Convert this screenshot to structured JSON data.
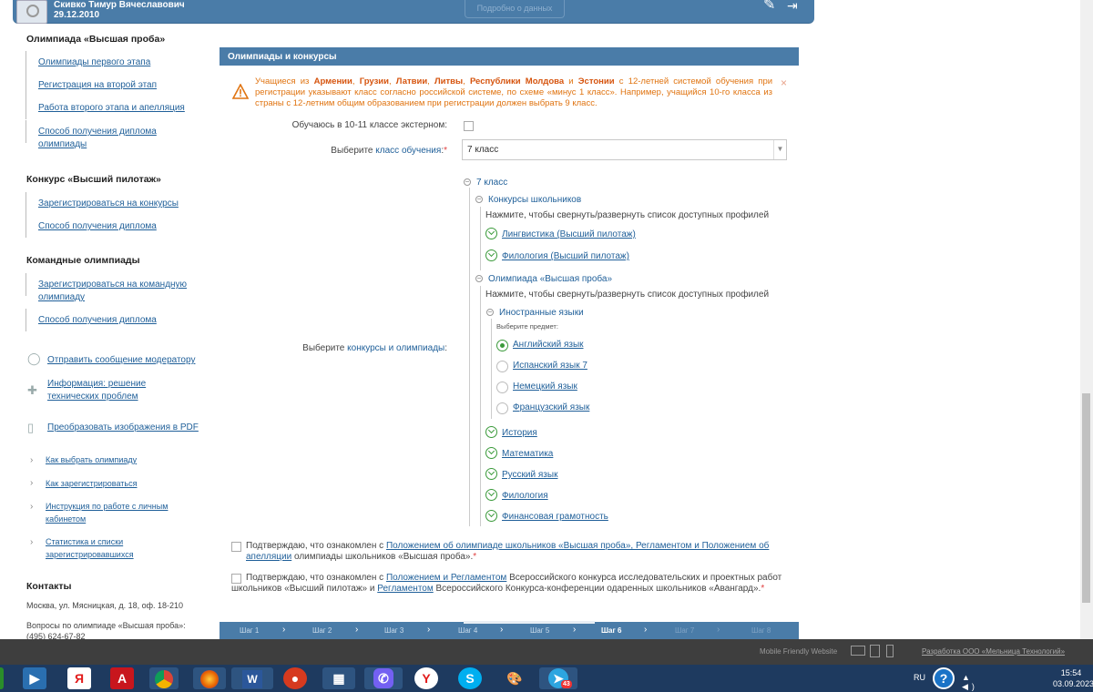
{
  "header": {
    "user_name": "Скивко Тимур Вячеславович",
    "user_date": "29.12.2010",
    "button_label": "Подробно о данных",
    "icons": [
      "pen-icon",
      "logout-icon"
    ]
  },
  "sidebar": {
    "section1_title": "Олимпиада «Высшая проба»",
    "section1_items": [
      "Олимпиады первого этапа",
      "Регистрация на второй этап",
      "Работа второго этапа и апелляция",
      "Способ получения диплома олимпиады"
    ],
    "section2_title": "Конкурс «Высший пилотаж»",
    "section2_items": [
      "Зарегистрироваться на конкурсы",
      "Способ получения диплома"
    ],
    "section3_title": "Командные олимпиады",
    "section3_items": [
      "Зарегистрироваться на командную олимпиаду",
      "Способ получения диплома"
    ],
    "actions": [
      "Отправить сообщение модератору",
      "Информация: решение технических проблем",
      "Преобразовать изображения в PDF"
    ],
    "guides": [
      "Как выбрать олимпиаду",
      "Как зарегистрироваться",
      "Инструкция по работе с личным кабинетом",
      "Статистика и списки зарегистрировавшихся"
    ],
    "contacts_title": "Контакты",
    "contacts_address": "Москва, ул. Мясницкая, д. 18, оф. 18-210",
    "contacts_questions": "Вопросы по олимпиаде «Высшая проба»:",
    "contacts_phone": "(495) 624-67-82"
  },
  "main": {
    "title": "Олимпиады и конкурсы",
    "warning": {
      "p1": "Учащиеся из ",
      "c1": "Армении",
      "c2": "Грузии",
      "c3": "Латвии",
      "c4": "Литвы",
      "c5": "Республики Молдова",
      "and": " и ",
      "c6": "Эстонии",
      "sep": ", ",
      "p2": " с 12-летней системой обучения при регистрации указывают класс согласно российской системе, по схеме «минус 1 класс». Например, учащийся 10-го класса из страны с 12-летним общим образованием при регистрации должен выбрать 9 класс.",
      "close": "×"
    },
    "extern_label": "Обучаюсь в 10-11 классе экстерном:",
    "class_label_prefix": "Выберите ",
    "class_label_link": "класс обучения",
    "class_label_suffix": ":",
    "class_value": "7 класс",
    "contests_label_prefix": "Выберите ",
    "contests_label_link": "конкурсы и олимпиады",
    "contests_label_suffix": ":",
    "required_mark": "*",
    "tree": {
      "root": "7 класс",
      "branch1": "Конкурсы школьников",
      "hint": "Нажмите, чтобы свернуть/развернуть список доступных профилей",
      "branch1_items": [
        "Лингвистика (Высший пилотаж)",
        "Филология (Высший пилотаж)"
      ],
      "branch2": "Олимпиада «Высшая проба»",
      "subbranch": "Иностранные языки",
      "subject_hint": "Выберите предмет:",
      "languages": [
        "Английский язык",
        "Испанский язык 7",
        "Немецкий язык",
        "Французский язык"
      ],
      "selected_language": 0,
      "branch2_items": [
        "История",
        "Математика",
        "Русский язык",
        "Филология",
        "Финансовая грамотность"
      ]
    },
    "confirm1": {
      "pre": "Подтверждаю, что ознакомлен с ",
      "link1": "Положением об олимпиаде школьников «Высшая проба», Регламентом и Положением об апелляции",
      "post": " олимпиады школьников «Высшая проба»."
    },
    "confirm2": {
      "pre": "Подтверждаю, что ознакомлен с ",
      "link1": "Положением и Регламентом",
      "mid": " Всероссийского конкурса исследовательских и проектных работ школьников «Высший пилотаж» и ",
      "link2": "Регламентом",
      "post": " Всероссийского Конкурса-конференции одаренных школьников «Авангард»."
    },
    "steps": [
      "Шаг 1",
      "Шаг 2",
      "Шаг 3",
      "Шаг 4",
      "Шаг 5",
      "Шаг 6",
      "Шаг 7",
      "Шаг 8"
    ],
    "active_step": 6
  },
  "footer": {
    "mobile": "Mobile Friendly Website",
    "developer": "Разработка ООО «Мельница Технологий»"
  },
  "taskbar": {
    "apps": [
      "media-player",
      "yandex-browser",
      "acrobat",
      "chrome",
      "firefox",
      "word",
      "video-app",
      "file-viewer",
      "viber",
      "yandex",
      "skype",
      "paint",
      "telegram"
    ],
    "telegram_badge": "43",
    "lang": "RU",
    "time": "15:54",
    "date": "03.09.2023"
  }
}
